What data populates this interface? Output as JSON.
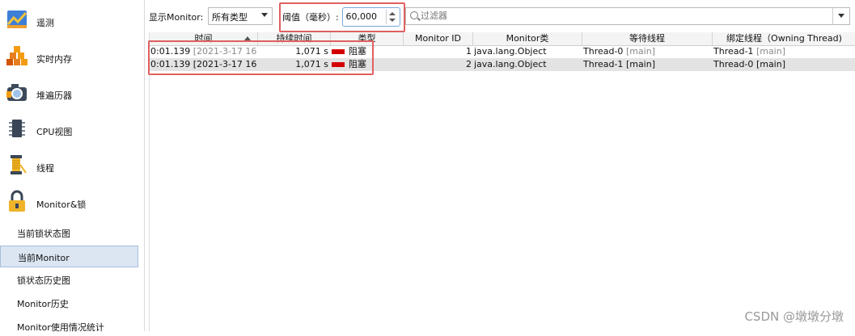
{
  "sidebar": {
    "items": [
      {
        "label": "遥测",
        "icon": "telemetry-icon"
      },
      {
        "label": "实时内存",
        "icon": "live-memory-icon"
      },
      {
        "label": "堆遍历器",
        "icon": "heap-walker-icon"
      },
      {
        "label": "CPU视图",
        "icon": "cpu-views-icon"
      },
      {
        "label": "线程",
        "icon": "threads-icon"
      },
      {
        "label": "Monitor&锁",
        "icon": "lock-icon"
      }
    ],
    "subitems": [
      "当前锁状态图",
      "当前Monitor",
      "锁状态历史图",
      "Monitor历史",
      "Monitor使用情况统计"
    ],
    "selected_subitem": "当前Monitor"
  },
  "toolbar": {
    "show_label": "显示Monitor:",
    "type_value": "所有类型",
    "threshold_label": "阈值（毫秒）:",
    "threshold_value": "60,000",
    "filter_placeholder": "过滤器"
  },
  "table": {
    "columns": [
      "时间",
      "持续时间",
      "类型",
      "Monitor ID",
      "Monitor类",
      "等待线程",
      "绑定线程（Owning Thread)"
    ],
    "rows": [
      {
        "time": "0:01.139",
        "time_detail": "[2021-3-17 16:...",
        "duration": "1,071 s",
        "type": "阻塞",
        "monitor_id": "1",
        "monitor_class": "java.lang.Object",
        "waiting_thread": "Thread-0",
        "waiting_group": "[main]",
        "owning_thread": "Thread-1",
        "owning_group": "[main]"
      },
      {
        "time": "0:01.139",
        "time_detail": "[2021-3-17 16:...",
        "duration": "1,071 s",
        "type": "阻塞",
        "monitor_id": "2",
        "monitor_class": "java.lang.Object",
        "waiting_thread": "Thread-1",
        "waiting_group": "[main]",
        "owning_thread": "Thread-0",
        "owning_group": "[main]"
      }
    ]
  },
  "watermark": "CSDN @墩墩分墩",
  "colors": {
    "highlight": "#e06060",
    "blocked": "#d40000",
    "selected_row": "#e3e3e3"
  }
}
